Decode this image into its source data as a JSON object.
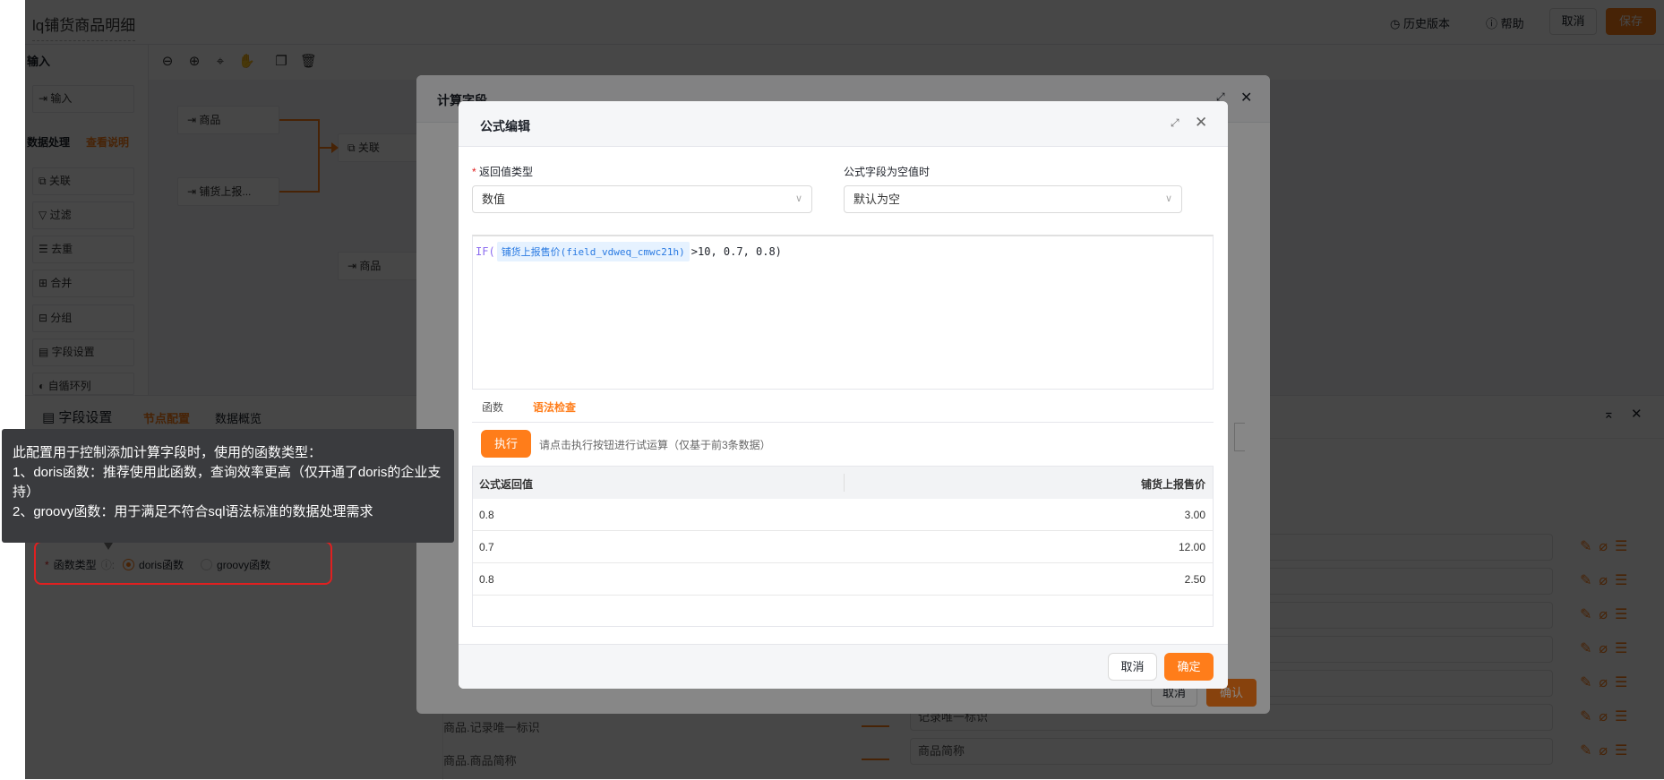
{
  "header": {
    "title": "lq铺货商品明细",
    "history_label": "历史版本",
    "help_label": "帮助",
    "cancel_label": "取消",
    "save_label": "保存"
  },
  "left_panel": {
    "input_title": "输入",
    "input_item": "输入",
    "processing_title": "数据处理",
    "view_docs_link": "查看说明",
    "items": [
      {
        "label": "关联",
        "icon": "join-icon"
      },
      {
        "label": "过滤",
        "icon": "filter-icon"
      },
      {
        "label": "去重",
        "icon": "dedupe-icon"
      },
      {
        "label": "合并",
        "icon": "merge-icon"
      },
      {
        "label": "分组",
        "icon": "group-icon"
      },
      {
        "label": "字段设置",
        "icon": "field-settings-icon"
      },
      {
        "label": "自循环列",
        "icon": "loop-icon"
      }
    ]
  },
  "canvas": {
    "nodes": [
      "商品",
      "铺货上报...",
      "关联",
      "商品"
    ]
  },
  "bottom_panel": {
    "title": "字段设置",
    "tabs": [
      "节点配置",
      "数据概览"
    ],
    "active_tab": "节点配置",
    "function_type_label": "函数类型",
    "radio_options": [
      "doris函数",
      "groovy函数"
    ],
    "selected": "doris函数",
    "field_rows": [
      {
        "source": "",
        "target": ""
      },
      {
        "source": "",
        "target": ""
      },
      {
        "source": "",
        "target": ""
      },
      {
        "source": "",
        "target": ""
      },
      {
        "source": "",
        "target": ""
      },
      {
        "source": "商品.记录唯一标识",
        "target": "记录唯一标识"
      },
      {
        "source": "商品.商品简称",
        "target": "商品简称"
      }
    ]
  },
  "tooltip": {
    "lines": [
      "此配置用于控制添加计算字段时，使用的函数类型：",
      "1、doris函数：推荐使用此函数，查询效率更高（仅开通了doris的企业支持）",
      "2、groovy函数：用于满足不符合sql语法标准的数据处理需求"
    ]
  },
  "calc_modal": {
    "title": "计算字段",
    "cancel_label": "取消",
    "confirm_label": "确认"
  },
  "formula_modal": {
    "title": "公式编辑",
    "return_type_label": "返回值类型",
    "return_type_value": "数值",
    "null_label": "公式字段为空值时",
    "null_value": "默认为空",
    "formula": {
      "fn": "IF(",
      "field_chip": "铺货上报售价(field_vdweq_cmwc21h)",
      "rest": ">10, 0.7, 0.8)"
    },
    "tabs": [
      "函数",
      "语法检查"
    ],
    "active_tab": "语法检查",
    "run_label": "执行",
    "run_hint": "请点击执行按钮进行试运算（仅基于前3条数据）",
    "table": {
      "columns": [
        "公式返回值",
        "铺货上报售价"
      ],
      "rows": [
        [
          "0.8",
          "3.00"
        ],
        [
          "0.7",
          "12.00"
        ],
        [
          "0.8",
          "2.50"
        ]
      ]
    },
    "cancel_label": "取消",
    "ok_label": "确定"
  },
  "colors": {
    "accent": "#ff7d1a",
    "annotation": "#e02020",
    "tooltip_bg": "#3a3b3e"
  }
}
